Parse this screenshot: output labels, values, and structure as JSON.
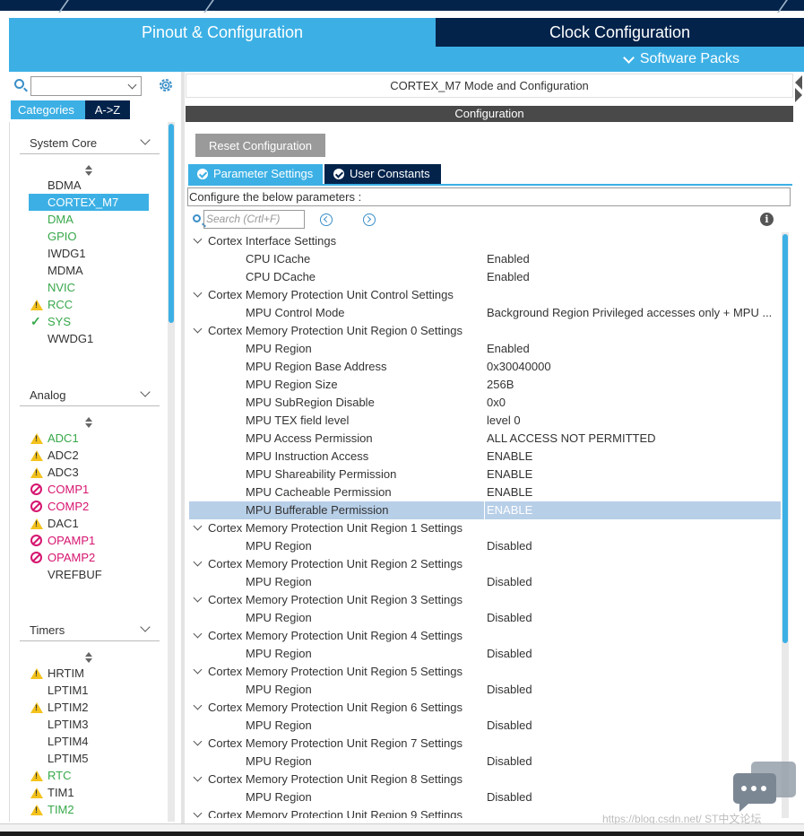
{
  "header": {
    "tabs": [
      "Pinout & Configuration",
      "Clock Configuration"
    ],
    "software_packs": "Software Packs"
  },
  "left_panel": {
    "search_placeholder": "",
    "category_tabs": [
      "Categories",
      "A->Z"
    ],
    "sections": [
      {
        "title": "System Core",
        "items": [
          {
            "label": "BDMA",
            "state": "normal"
          },
          {
            "label": "CORTEX_M7",
            "state": "selected"
          },
          {
            "label": "DMA",
            "state": "green"
          },
          {
            "label": "GPIO",
            "state": "green"
          },
          {
            "label": "IWDG1",
            "state": "normal"
          },
          {
            "label": "MDMA",
            "state": "normal"
          },
          {
            "label": "NVIC",
            "state": "green"
          },
          {
            "label": "RCC",
            "state": "warning"
          },
          {
            "label": "SYS",
            "state": "ok"
          },
          {
            "label": "WWDG1",
            "state": "normal"
          }
        ]
      },
      {
        "title": "Analog",
        "items": [
          {
            "label": "ADC1",
            "state": "warning-green"
          },
          {
            "label": "ADC2",
            "state": "warning"
          },
          {
            "label": "ADC3",
            "state": "warning"
          },
          {
            "label": "COMP1",
            "state": "disabled"
          },
          {
            "label": "COMP2",
            "state": "disabled"
          },
          {
            "label": "DAC1",
            "state": "warning"
          },
          {
            "label": "OPAMP1",
            "state": "disabled"
          },
          {
            "label": "OPAMP2",
            "state": "disabled"
          },
          {
            "label": "VREFBUF",
            "state": "normal"
          }
        ]
      },
      {
        "title": "Timers",
        "items": [
          {
            "label": "HRTIM",
            "state": "warning"
          },
          {
            "label": "LPTIM1",
            "state": "normal"
          },
          {
            "label": "LPTIM2",
            "state": "warning"
          },
          {
            "label": "LPTIM3",
            "state": "normal"
          },
          {
            "label": "LPTIM4",
            "state": "normal"
          },
          {
            "label": "LPTIM5",
            "state": "normal"
          },
          {
            "label": "RTC",
            "state": "warning-green"
          },
          {
            "label": "TIM1",
            "state": "warning"
          },
          {
            "label": "TIM2",
            "state": "warning-green"
          }
        ]
      }
    ]
  },
  "main": {
    "mode_title": "CORTEX_M7 Mode and Configuration",
    "config_title": "Configuration",
    "reset_button": "Reset Configuration",
    "param_tabs": [
      "Parameter Settings",
      "User Constants"
    ],
    "configure_text": "Configure the below parameters :",
    "search_placeholder": "Search (Crtl+F)",
    "info": "i",
    "rows": [
      {
        "type": "group",
        "label": "Cortex Interface Settings"
      },
      {
        "type": "param",
        "name": "CPU ICache",
        "value": "Enabled"
      },
      {
        "type": "param",
        "name": "CPU DCache",
        "value": "Enabled"
      },
      {
        "type": "group",
        "label": "Cortex Memory Protection Unit Control Settings"
      },
      {
        "type": "param",
        "name": "MPU Control Mode",
        "value": "Background Region Privileged accesses only + MPU ..."
      },
      {
        "type": "group",
        "label": "Cortex Memory Protection Unit Region 0 Settings"
      },
      {
        "type": "param",
        "name": "MPU Region",
        "value": "Enabled"
      },
      {
        "type": "param",
        "name": "MPU Region Base Address",
        "value": "0x30040000"
      },
      {
        "type": "param",
        "name": "MPU Region Size",
        "value": "256B"
      },
      {
        "type": "param",
        "name": "MPU SubRegion Disable",
        "value": "0x0"
      },
      {
        "type": "param",
        "name": "MPU TEX field level",
        "value": "level 0"
      },
      {
        "type": "param",
        "name": "MPU Access Permission",
        "value": "ALL ACCESS NOT PERMITTED"
      },
      {
        "type": "param",
        "name": "MPU Instruction Access",
        "value": "ENABLE"
      },
      {
        "type": "param",
        "name": "MPU Shareability Permission",
        "value": "ENABLE"
      },
      {
        "type": "param",
        "name": "MPU Cacheable Permission",
        "value": "ENABLE"
      },
      {
        "type": "param",
        "name": "MPU Bufferable  Permission",
        "value": "ENABLE",
        "highlight": true
      },
      {
        "type": "group",
        "label": "Cortex Memory Protection Unit Region 1 Settings"
      },
      {
        "type": "param",
        "name": "MPU Region",
        "value": "Disabled"
      },
      {
        "type": "group",
        "label": "Cortex Memory Protection Unit Region 2 Settings"
      },
      {
        "type": "param",
        "name": "MPU Region",
        "value": "Disabled"
      },
      {
        "type": "group",
        "label": "Cortex Memory Protection Unit Region 3 Settings"
      },
      {
        "type": "param",
        "name": "MPU Region",
        "value": "Disabled"
      },
      {
        "type": "group",
        "label": "Cortex Memory Protection Unit Region 4 Settings"
      },
      {
        "type": "param",
        "name": "MPU Region",
        "value": "Disabled"
      },
      {
        "type": "group",
        "label": "Cortex Memory Protection Unit Region 5 Settings"
      },
      {
        "type": "param",
        "name": "MPU Region",
        "value": "Disabled"
      },
      {
        "type": "group",
        "label": "Cortex Memory Protection Unit Region 6 Settings"
      },
      {
        "type": "param",
        "name": "MPU Region",
        "value": "Disabled"
      },
      {
        "type": "group",
        "label": "Cortex Memory Protection Unit Region 7 Settings"
      },
      {
        "type": "param",
        "name": "MPU Region",
        "value": "Disabled"
      },
      {
        "type": "group",
        "label": "Cortex Memory Protection Unit Region 8 Settings"
      },
      {
        "type": "param",
        "name": "MPU Region",
        "value": "Disabled"
      },
      {
        "type": "group",
        "label": "Cortex Memory Protection Unit Region 9 Settings"
      }
    ]
  },
  "watermark": "https://blog.csdn.net/   ST中文论坛",
  "colors": {
    "accent": "#3cb0e5",
    "navy": "#03234b",
    "green": "#37a84a",
    "pink": "#d6156f",
    "warning": "#f4c21c",
    "highlight": "#b8cfe8"
  }
}
